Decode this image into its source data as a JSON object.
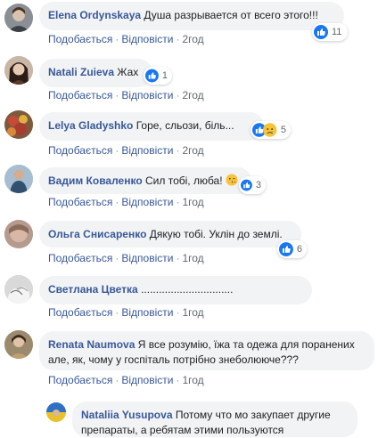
{
  "comments": [
    {
      "author": "Elena Ordynskaya",
      "text": "Душа разрывается от всего этого!!!",
      "like_label": "Подобається",
      "reply_label": "Відповісти",
      "time": "2год",
      "reaction_count": "11",
      "reactions": [
        "like-icon"
      ]
    },
    {
      "author": "Natali Zuieva",
      "text": "Жах",
      "like_label": "Подобається",
      "reply_label": "Відповісти",
      "time": "2год",
      "reaction_count": "1",
      "reactions": [
        "like-icon"
      ]
    },
    {
      "author": "Lelya Gladyshko",
      "text": "Горе, сльози, біль...",
      "like_label": "Подобається",
      "reply_label": "Відповісти",
      "time": "2год",
      "reaction_count": "5",
      "reactions": [
        "like-icon",
        "sad-icon"
      ]
    },
    {
      "author": "Вадим Коваленко",
      "text": "Сил тобі, люба!",
      "like_label": "Подобається",
      "reply_label": "Відповісти",
      "time": "1год",
      "reaction_count": "3",
      "reactions": [
        "wink-kiss-emoji"
      ]
    },
    {
      "author": "Ольга Снисаренко",
      "text": "Дякую тобі. Уклін до землі.",
      "like_label": "Подобається",
      "reply_label": "Відповісти",
      "time": "1год",
      "reaction_count": "6",
      "reactions": [
        "like-icon"
      ]
    },
    {
      "author": "Светлана Цветка",
      "text": "...............................",
      "like_label": "Подобається",
      "reply_label": "Відповісти",
      "time": "1год",
      "reaction_count": "",
      "reactions": []
    },
    {
      "author": "Renata Naumova",
      "text_line1": "Я все розумію, їжа та одежа для поранених",
      "text_line2": "але, як, чому у госпіталь потрібно знеболююче???",
      "like_label": "Подобається",
      "reply_label": "Відповісти",
      "time": "1год"
    },
    {
      "author": "Nataliia Yusupova",
      "text_line1": "Потому что мо закупает другие",
      "text_line2": "препараты, а ребятам этими пользуются"
    }
  ],
  "colors": {
    "link": "#385898",
    "bubble": "#f2f3f5",
    "like_blue": "#1877f2"
  }
}
